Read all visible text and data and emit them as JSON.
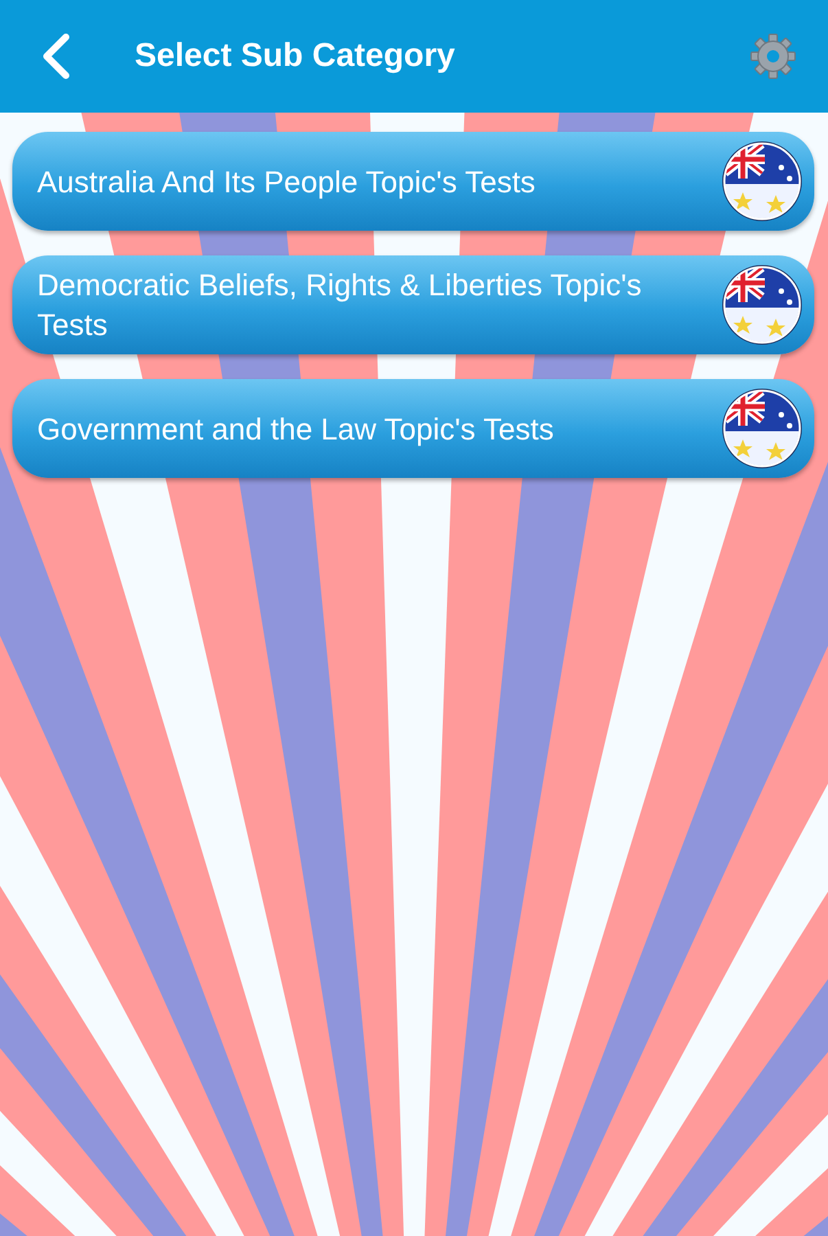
{
  "header": {
    "title": "Select Sub Category"
  },
  "items": [
    {
      "label": "Australia And Its People Topic's Tests"
    },
    {
      "label": "Democratic Beliefs, Rights & Liberties Topic's Tests"
    },
    {
      "label": "Government and the Law Topic's Tests"
    }
  ]
}
